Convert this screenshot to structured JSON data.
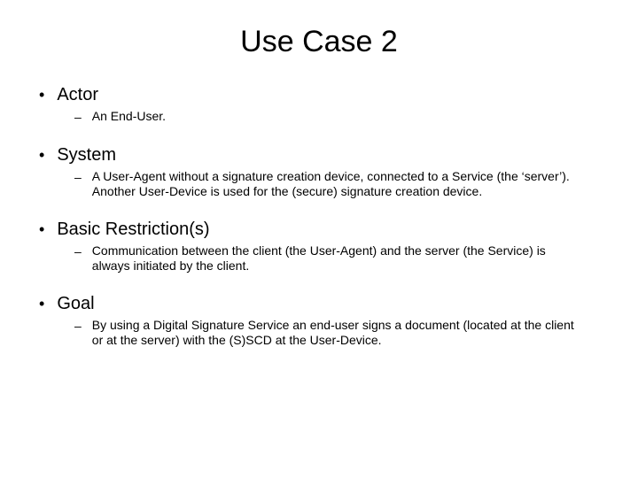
{
  "title": "Use Case 2",
  "items": [
    {
      "heading": "Actor",
      "body": "An End-User."
    },
    {
      "heading": "System",
      "body": "A User-Agent without a signature creation device, connected to a Service (the ‘server’). Another User-Device is used for the (secure) signature creation device."
    },
    {
      "heading": "Basic Restriction(s)",
      "body": "Communication between the client (the User-Agent) and the server (the Service) is always initiated by the client."
    },
    {
      "heading": "Goal",
      "body": "By using a Digital Signature Service an end-user signs a document (located at the client or at the server) with the (S)SCD at the User-Device."
    }
  ]
}
